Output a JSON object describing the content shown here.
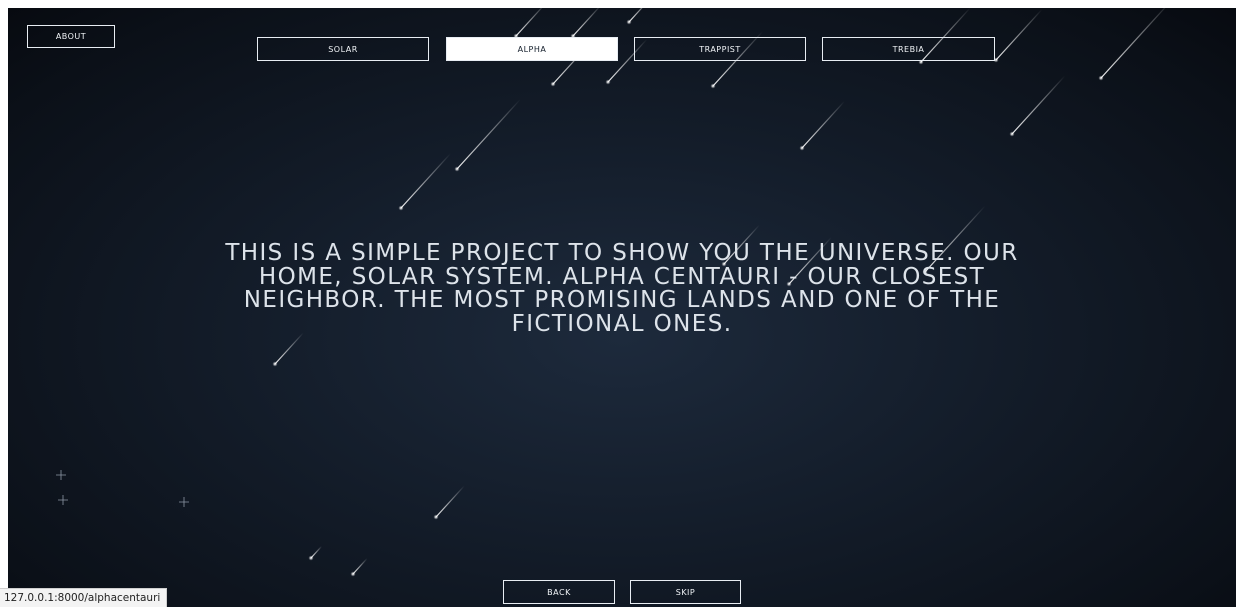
{
  "header": {
    "about_label": "ABOUT",
    "tabs": [
      {
        "label": "SOLAR",
        "active": false
      },
      {
        "label": "ALPHA",
        "active": true
      },
      {
        "label": "TRAPPIST",
        "active": false
      },
      {
        "label": "TREBIA",
        "active": false
      }
    ]
  },
  "main": {
    "intro_text": "This is a simple project to show you the universe. Our home, solar system. Alpha Centauri - our closest neighbor. The most promising lands and one of the fictional ones."
  },
  "footer": {
    "back_label": "BACK",
    "skip_label": "SKIP"
  },
  "status_bar": {
    "url": "127.0.0.1:8000/alphacentauri"
  },
  "colors": {
    "background": "#131c29",
    "text": "#dde3ea",
    "button_border": "#e8edf3",
    "active_tab_bg": "#ffffff"
  }
}
